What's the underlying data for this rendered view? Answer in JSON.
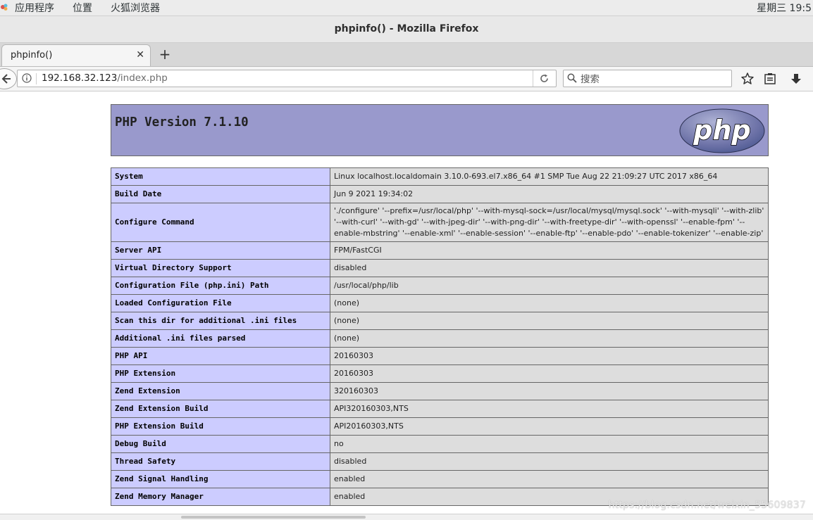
{
  "topbar": {
    "menus": [
      "应用程序",
      "位置",
      "火狐浏览器"
    ],
    "clock": "星期三 19:5"
  },
  "window": {
    "title": "phpinfo() - Mozilla Firefox"
  },
  "tabs": [
    {
      "label": "phpinfo()"
    }
  ],
  "navbar": {
    "url_host": "192.168.32.123",
    "url_path": "/index.php",
    "search_placeholder": "搜索"
  },
  "php": {
    "version_title": "PHP Version 7.1.10",
    "logo_text": "php",
    "rows": [
      {
        "key": "System",
        "value": "Linux localhost.localdomain 3.10.0-693.el7.x86_64 #1 SMP Tue Aug 22 21:09:27 UTC 2017 x86_64"
      },
      {
        "key": "Build Date",
        "value": "Jun 9 2021 19:34:02"
      },
      {
        "key": "Configure Command",
        "value": "'./configure' '--prefix=/usr/local/php' '--with-mysql-sock=/usr/local/mysql/mysql.sock' '--with-mysqli' '--with-zlib' '--with-curl' '--with-gd' '--with-jpeg-dir' '--with-png-dir' '--with-freetype-dir' '--with-openssl' '--enable-fpm' '--enable-mbstring' '--enable-xml' '--enable-session' '--enable-ftp' '--enable-pdo' '--enable-tokenizer' '--enable-zip'"
      },
      {
        "key": "Server API",
        "value": "FPM/FastCGI"
      },
      {
        "key": "Virtual Directory Support",
        "value": "disabled"
      },
      {
        "key": "Configuration File (php.ini) Path",
        "value": "/usr/local/php/lib"
      },
      {
        "key": "Loaded Configuration File",
        "value": "(none)"
      },
      {
        "key": "Scan this dir for additional .ini files",
        "value": "(none)"
      },
      {
        "key": "Additional .ini files parsed",
        "value": "(none)"
      },
      {
        "key": "PHP API",
        "value": "20160303"
      },
      {
        "key": "PHP Extension",
        "value": "20160303"
      },
      {
        "key": "Zend Extension",
        "value": "320160303"
      },
      {
        "key": "Zend Extension Build",
        "value": "API320160303,NTS"
      },
      {
        "key": "PHP Extension Build",
        "value": "API20160303,NTS"
      },
      {
        "key": "Debug Build",
        "value": "no"
      },
      {
        "key": "Thread Safety",
        "value": "disabled"
      },
      {
        "key": "Zend Signal Handling",
        "value": "enabled"
      },
      {
        "key": "Zend Memory Manager",
        "value": "enabled"
      }
    ]
  },
  "watermark": "https://blog.csdn.net/weixin_55609837"
}
